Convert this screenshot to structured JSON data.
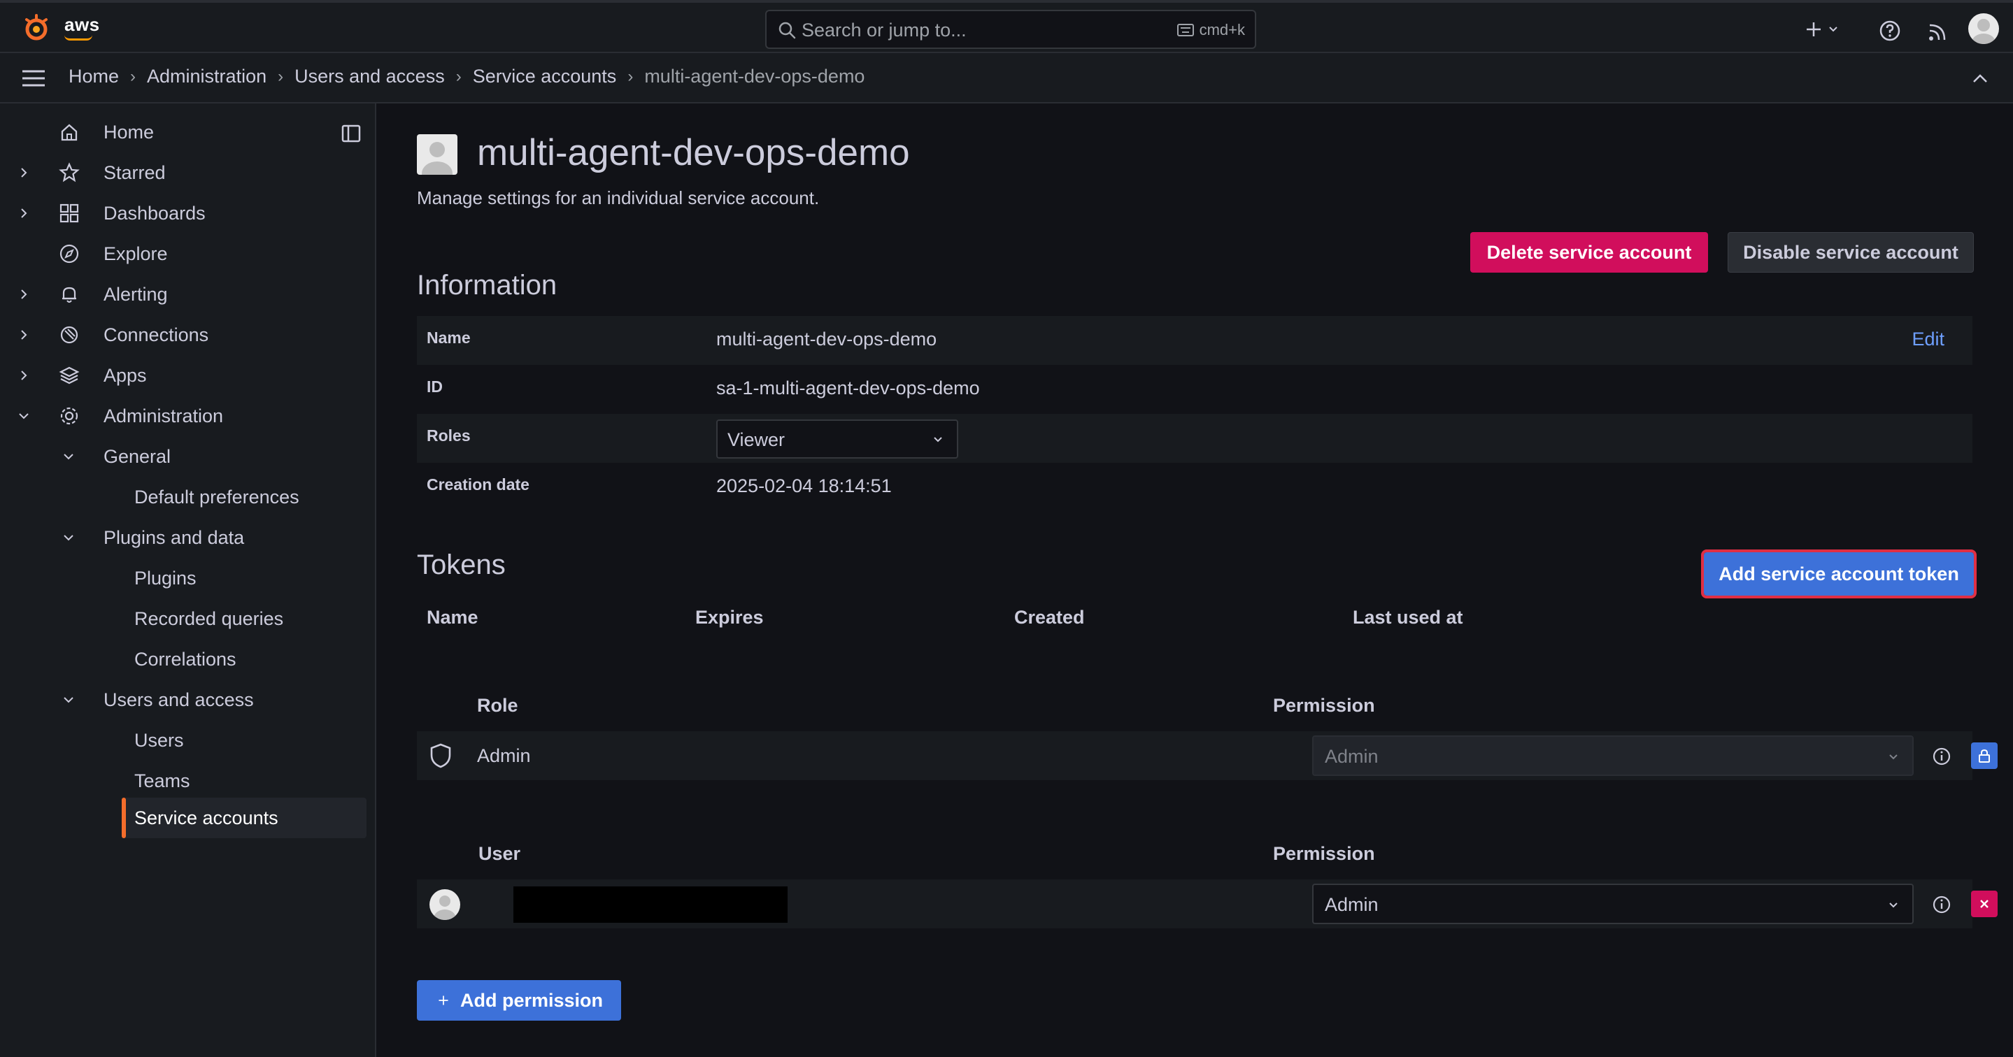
{
  "topbar": {
    "brand": "aws",
    "search_placeholder": "Search or jump to...",
    "search_shortcut": "cmd+k",
    "icons": [
      "grafana-logo-icon",
      "search-icon",
      "keyboard-icon",
      "plus-icon",
      "help-icon",
      "news-icon",
      "user-avatar-icon"
    ]
  },
  "breadcrumb": {
    "items": [
      "Home",
      "Administration",
      "Users and access",
      "Service accounts"
    ],
    "current": "multi-agent-dev-ops-demo"
  },
  "sidebar": {
    "items": [
      {
        "label": "Home",
        "icon": "home-icon"
      },
      {
        "label": "Starred",
        "icon": "star-icon"
      },
      {
        "label": "Dashboards",
        "icon": "dashboards-icon"
      },
      {
        "label": "Explore",
        "icon": "compass-icon"
      },
      {
        "label": "Alerting",
        "icon": "bell-icon"
      },
      {
        "label": "Connections",
        "icon": "connections-icon"
      },
      {
        "label": "Apps",
        "icon": "layers-icon"
      },
      {
        "label": "Administration",
        "icon": "gear-icon"
      },
      {
        "label": "General"
      },
      {
        "label": "Default preferences"
      },
      {
        "label": "Plugins and data"
      },
      {
        "label": "Plugins"
      },
      {
        "label": "Recorded queries"
      },
      {
        "label": "Correlations"
      },
      {
        "label": "Users and access"
      },
      {
        "label": "Users"
      },
      {
        "label": "Teams"
      },
      {
        "label": "Service accounts",
        "active": true
      }
    ]
  },
  "page": {
    "title": "multi-agent-dev-ops-demo",
    "subtitle": "Manage settings for an individual service account.",
    "delete_button": "Delete service account",
    "disable_button": "Disable service account"
  },
  "information": {
    "title": "Information",
    "name_label": "Name",
    "name_value": "multi-agent-dev-ops-demo",
    "edit_label": "Edit",
    "id_label": "ID",
    "id_value": "sa-1-multi-agent-dev-ops-demo",
    "roles_label": "Roles",
    "roles_value": "Viewer",
    "creation_label": "Creation date",
    "creation_value": "2025-02-04 18:14:51"
  },
  "tokens": {
    "title": "Tokens",
    "add_button": "Add service account token",
    "columns": [
      "Name",
      "Expires",
      "Created",
      "Last used at"
    ]
  },
  "permissions": {
    "role_header": "Role",
    "permission_header": "Permission",
    "role_row": {
      "role": "Admin",
      "permission": "Admin"
    },
    "user_header": "User",
    "user_row": {
      "permission": "Admin"
    },
    "add_button": "Add permission"
  },
  "colors": {
    "background": "#111217",
    "panel": "#181b1f",
    "danger": "#d10e5c",
    "primary": "#3d71d9",
    "active_accent": "#f46d2b",
    "highlight_outline": "#e02f44"
  }
}
